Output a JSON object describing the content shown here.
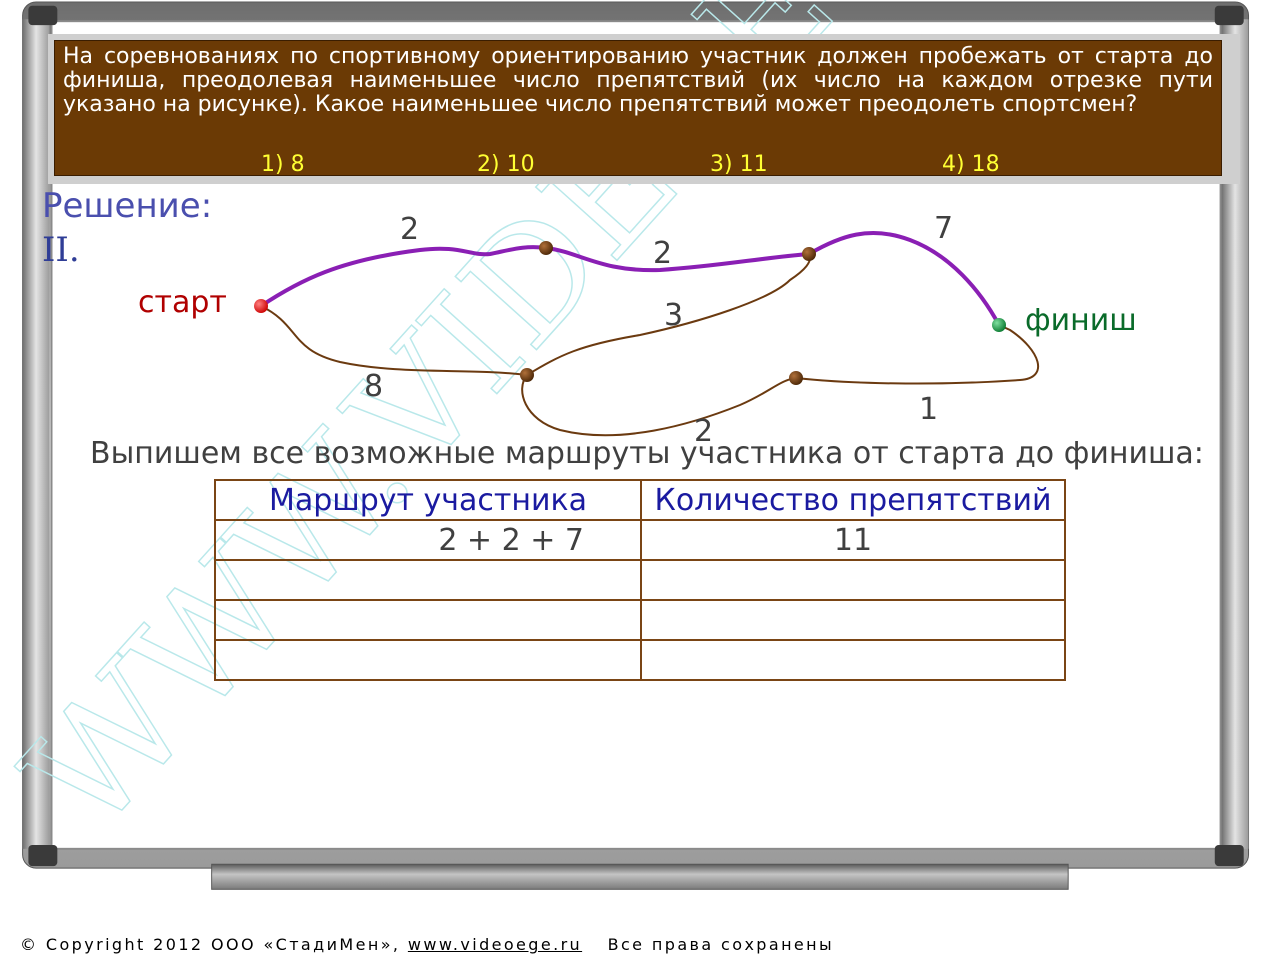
{
  "problem": {
    "text": "На соревнованиях по спортивному ориентированию участник должен пробежать от старта до финиша, преодолевая наименьшее число препятствий (их число на каждом отрезке пути указано на рисунке). Какое наименьшее число препятствий может преодолеть спортсмен?",
    "answers": [
      "1) 8",
      "2) 10",
      "3) 11",
      "4) 18"
    ]
  },
  "solution": {
    "title": "Решение:",
    "part": "II."
  },
  "graph": {
    "start_label": "старт",
    "finish_label": "финиш",
    "edge_weights": [
      "2",
      "2",
      "7",
      "3",
      "8",
      "2",
      "1"
    ],
    "highlight_color": "#8a1fb4",
    "edge_color": "#6b3a10"
  },
  "intro": "Выпишем все возможные маршруты участника от старта до финиша:",
  "table": {
    "headers": [
      "Маршрут участника",
      "Количество препятствий"
    ],
    "rows": [
      [
        "2 + 2 + 7",
        "11"
      ],
      [
        "",
        ""
      ],
      [
        "",
        ""
      ],
      [
        "",
        ""
      ]
    ]
  },
  "watermark": "WWW.VIDEOEGE.RU",
  "footer": {
    "copyright_symbol": "©",
    "text": "Copyright 2012 ООО «СтадиМен»,",
    "link": "www.videoege.ru",
    "rights": "Все права сохранены"
  }
}
